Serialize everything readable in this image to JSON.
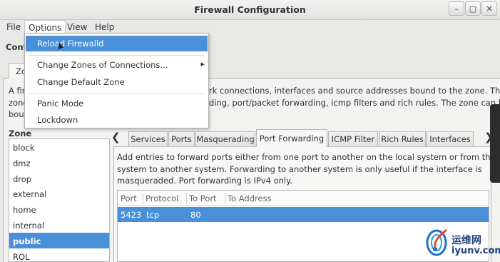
{
  "window": {
    "title": "Firewall Configuration",
    "controls": {
      "minimize": "–",
      "maximize": "▢",
      "close": "✕"
    }
  },
  "menubar": {
    "file": "File",
    "options": "Options",
    "view": "View",
    "help": "Help"
  },
  "options_menu": {
    "reload": "Reload Firewalld",
    "change_zones": "Change Zones of Connections...",
    "change_default": "Change Default Zone",
    "panic": "Panic Mode",
    "lockdown": "Lockdown"
  },
  "section_label": "Conf",
  "outer_tab": "Zon",
  "zone_description": {
    "line1_left": "A fir",
    "line1_right": "rk connections, interfaces and source addresses bound to the zone. The",
    "line2_left": "zone",
    "line2_right": "ding, port/packet forwarding, icmp filters and rich rules. The zone can be",
    "line3_left": "bour"
  },
  "zones": {
    "label": "Zone",
    "items": [
      "block",
      "dmz",
      "drop",
      "external",
      "home",
      "internal",
      "public",
      "ROL"
    ],
    "selected": "public"
  },
  "tabs": [
    "Services",
    "Ports",
    "Masquerading",
    "Port Forwarding",
    "ICMP Filter",
    "Rich Rules",
    "Interfaces"
  ],
  "active_tab": "Port Forwarding",
  "port_forwarding": {
    "description": [
      "Add entries to forward ports either from one port to another on the local system or from the local",
      "system to another system. Forwarding to another system is only useful if the interface is",
      "masqueraded. Port forwarding is IPv4 only."
    ],
    "columns": [
      "Port",
      "Protocol",
      "To Port",
      "To Address"
    ],
    "rows": [
      {
        "port": "5423",
        "protocol": "tcp",
        "to_port": "80",
        "to_address": ""
      }
    ]
  },
  "watermark": {
    "brand": "运维网",
    "domain": "iyunv.com"
  },
  "colors": {
    "selection": "#4a90d9",
    "brand_text": "#1e3f7a"
  }
}
